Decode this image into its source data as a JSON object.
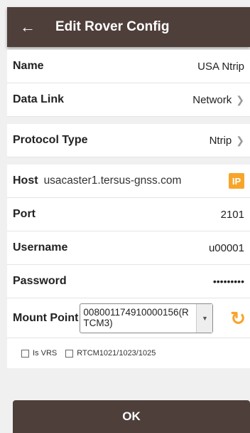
{
  "header": {
    "back_icon": "back-arrow-icon",
    "title": "Edit Rover Config"
  },
  "rows": {
    "name": {
      "label": "Name",
      "value": "USA Ntrip"
    },
    "data_link": {
      "label": "Data Link",
      "value": "Network"
    },
    "protocol": {
      "label": "Protocol Type",
      "value": "Ntrip"
    },
    "host": {
      "label": "Host",
      "value": "usacaster1.tersus-gnss.com",
      "badge": "IP"
    },
    "port": {
      "label": "Port",
      "value": "2101"
    },
    "username": {
      "label": "Username",
      "value": "u00001"
    },
    "password": {
      "label": "Password",
      "value": "•••••••••"
    },
    "mount_point": {
      "label": "Mount Point",
      "value": "008001174910000156(RTCM3)"
    }
  },
  "checkboxes": {
    "is_vrs": {
      "label": "Is VRS",
      "checked": false
    },
    "rtcm": {
      "label": "RTCM1021/1023/1025",
      "checked": false
    }
  },
  "ok_label": "OK",
  "colors": {
    "header": "#4e3f3a",
    "accent": "#f7a52a",
    "background": "#f0f0f0"
  }
}
